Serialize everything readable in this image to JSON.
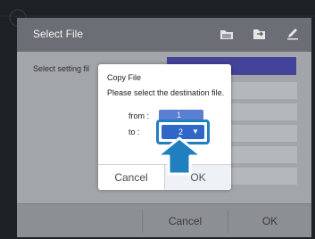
{
  "screen": {
    "title": "Select File",
    "setting_label": "Select setting fil",
    "header_icons": [
      "folder-icon",
      "copy-file-icon",
      "edit-icon"
    ]
  },
  "footer": {
    "cancel_label": "Cancel",
    "ok_label": "OK"
  },
  "dialog": {
    "title": "Copy File",
    "message": "Please select the destination file.",
    "from_label": "from :",
    "from_value": "1",
    "to_label": "to :",
    "to_value": "2",
    "cancel_label": "Cancel",
    "ok_label": "OK"
  },
  "colors": {
    "highlight": "#1f7fbf",
    "select_blue": "#2f67c8",
    "header_bar": "#44439a"
  }
}
